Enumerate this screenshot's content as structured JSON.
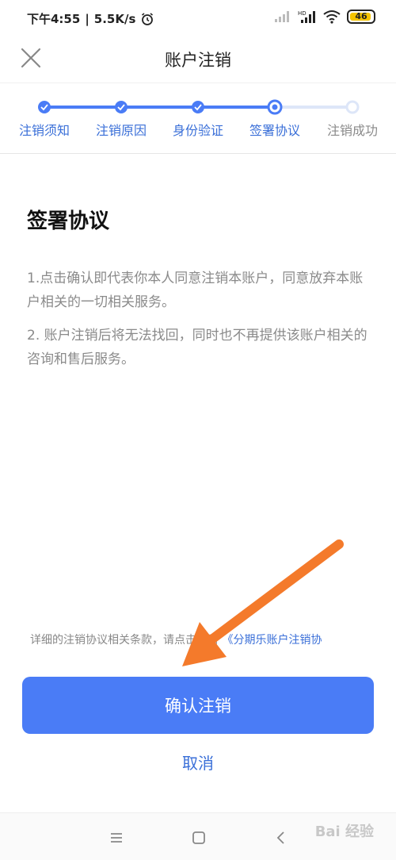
{
  "status_bar": {
    "time": "下午4:55",
    "speed": "5.5K/s",
    "battery": "46"
  },
  "nav": {
    "title": "账户注销"
  },
  "steps": [
    {
      "label": "注销须知",
      "state": "done"
    },
    {
      "label": "注销原因",
      "state": "done"
    },
    {
      "label": "身份验证",
      "state": "done"
    },
    {
      "label": "签署协议",
      "state": "current"
    },
    {
      "label": "注销成功",
      "state": "pending"
    }
  ],
  "content": {
    "title": "签署协议",
    "para1": "1.点击确认即代表你本人同意注销本账户，同意放弃本账户相关的一切相关服务。",
    "para2": "2. 账户注销后将无法找回，同时也不再提供该账户相关的咨询和售后服务。"
  },
  "notice": {
    "prefix": "详细的注销协议相关条款，请点击查看",
    "link": "《分期乐账户注销协"
  },
  "actions": {
    "confirm": "确认注销",
    "cancel": "取消"
  },
  "colors": {
    "accent": "#4a7cf6",
    "link": "#3a6fd8",
    "arrow": "#f47a2b"
  },
  "watermark": "Bai 经验"
}
